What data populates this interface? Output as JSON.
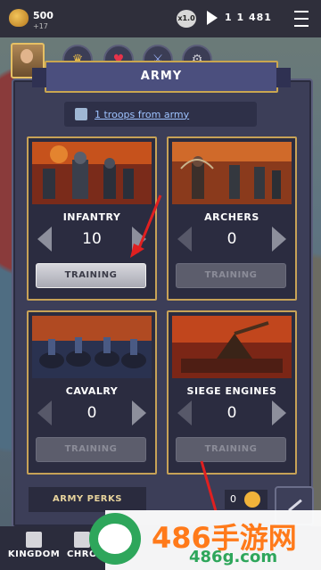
{
  "topbar": {
    "gold_amount": "500",
    "gold_income": "+17",
    "speed": "x1.0",
    "date": "1 1 481"
  },
  "tabs": [
    {
      "name": "crown-icon",
      "glyph": "♛",
      "color": "#f0c24b"
    },
    {
      "name": "heart-icon",
      "glyph": "♥",
      "color": "#e6334a"
    },
    {
      "name": "sword-icon",
      "glyph": "⚔",
      "color": "#9fb7ff"
    },
    {
      "name": "gear-icon",
      "glyph": "⚙",
      "color": "#c9c9d2"
    }
  ],
  "panel": {
    "title": "ARMY",
    "info_link": "1 troops from army"
  },
  "units": [
    {
      "name": "INFANTRY",
      "count": "10",
      "button": "TRAINING",
      "active": true
    },
    {
      "name": "ARCHERS",
      "count": "0",
      "button": "TRAINING",
      "active": false
    },
    {
      "name": "CAVALRY",
      "count": "0",
      "button": "TRAINING",
      "active": false
    },
    {
      "name": "SIEGE ENGINES",
      "count": "0",
      "button": "TRAINING",
      "active": false
    }
  ],
  "footer": {
    "perks_label": "ARMY PERKS",
    "counter": "0"
  },
  "bottom_nav": [
    {
      "label": "KINGDOM"
    },
    {
      "label": "CHRO"
    }
  ],
  "watermark": {
    "brand": "486手游网",
    "domain": "486g.com"
  },
  "colors": {
    "accent_gold": "#c7a257",
    "panel_bg": "#3c3e58",
    "annotation_red": "#e02020"
  }
}
